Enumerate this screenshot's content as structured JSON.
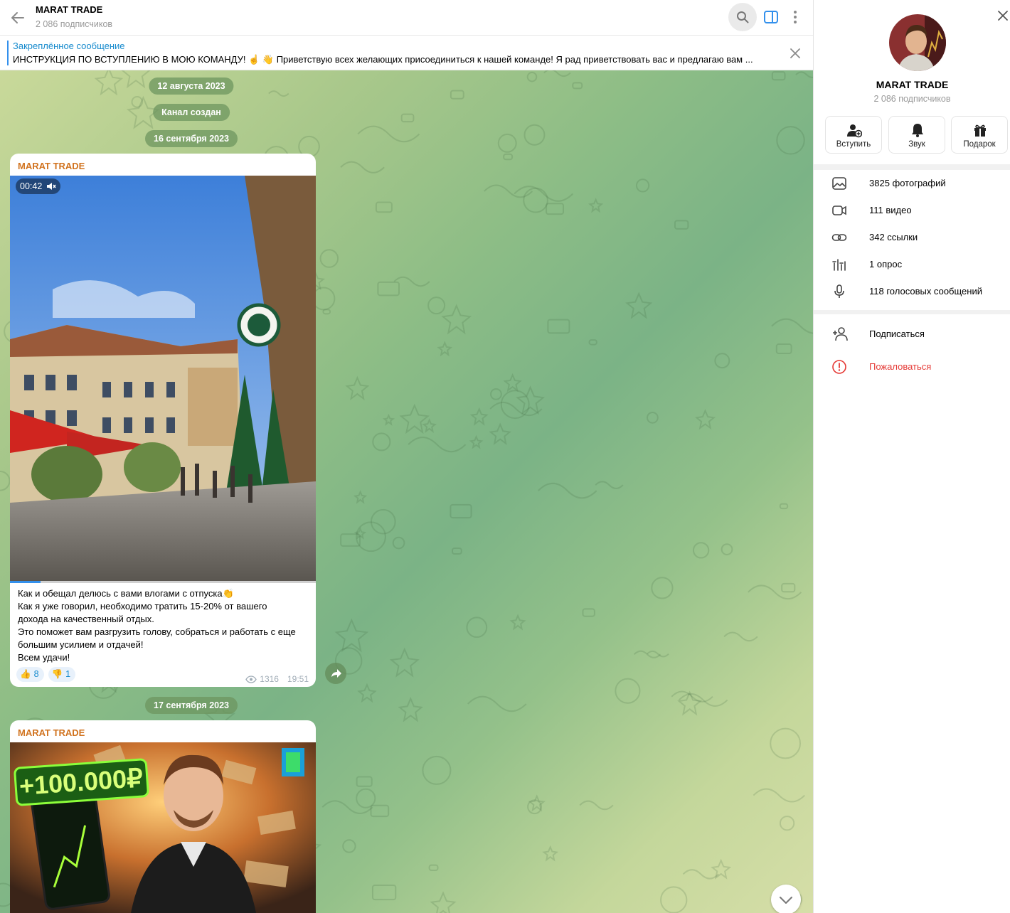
{
  "header": {
    "title": "MARAT TRADE",
    "subtitle": "2 086 подписчиков"
  },
  "pinned": {
    "title": "Закреплённое сообщение",
    "text": "ИНСТРУКЦИЯ ПО ВСТУПЛЕНИЮ В МОЮ КОМАНДУ! ☝️ 👋 Приветствую всех желающих присоединиться к нашей команде! Я рад приветствовать вас и предлагаю вам ..."
  },
  "feed": {
    "dates": [
      "12 августа 2023",
      "Канал создан",
      "16 сентября 2023",
      "17 сентября 2023"
    ],
    "messages": [
      {
        "author": "MARAT TRADE",
        "video_duration": "00:42",
        "video_progress": 0.1,
        "text_lines": [
          "Как и обещал делюсь с вами влогами с отпуска👏",
          "Как я уже говорил, необходимо тратить 15-20% от вашего",
          "дохода на качественный отдых.",
          "Это поможет вам разгрузить голову, собраться и работать с еще",
          "большим усилием и отдачей!",
          "Всем удачи!"
        ],
        "reactions": [
          {
            "emoji": "👍",
            "count": "8"
          },
          {
            "emoji": "👎",
            "count": "1"
          }
        ],
        "views": "1316",
        "time": "19:51"
      },
      {
        "author": "MARAT TRADE",
        "image_text": "+100.000₽"
      }
    ]
  },
  "side_panel": {
    "title": "MARAT TRADE",
    "subtitle": "2 086 подписчиков",
    "actions": [
      {
        "label": "Вступить",
        "icon": "add-user-icon"
      },
      {
        "label": "Звук",
        "icon": "bell-icon"
      },
      {
        "label": "Подарок",
        "icon": "gift-icon"
      }
    ],
    "media": [
      {
        "label": "3825 фотографий",
        "icon": "photo-icon"
      },
      {
        "label": "111 видео",
        "icon": "video-icon"
      },
      {
        "label": "342 ссылки",
        "icon": "link-icon"
      },
      {
        "label": "1 опрос",
        "icon": "poll-icon"
      },
      {
        "label": "118 голосовых сообщений",
        "icon": "microphone-icon"
      }
    ],
    "subscribe_label": "Подписаться",
    "report_label": "Пожаловаться"
  },
  "colors": {
    "accent": "#3390ec",
    "link": "#168acd",
    "author": "#d1731f",
    "danger": "#e53935"
  }
}
